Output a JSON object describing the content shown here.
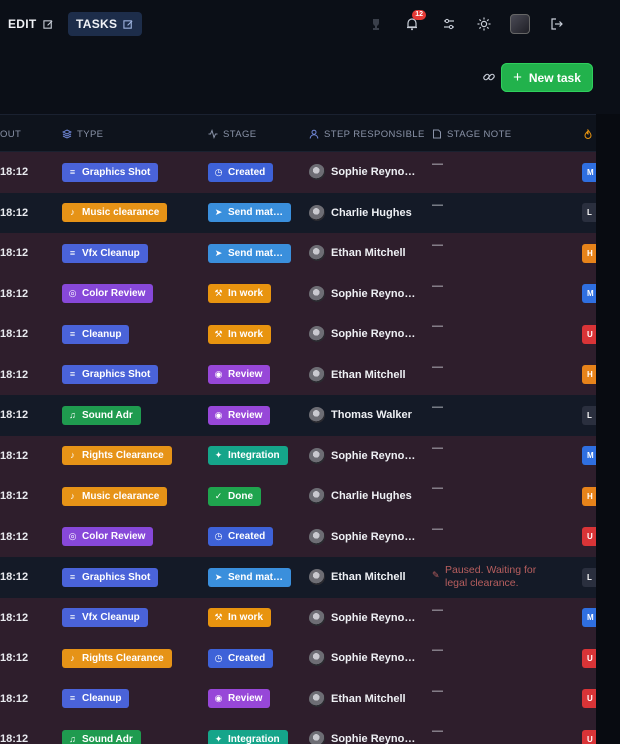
{
  "topbar": {
    "edit_label": "EDIT",
    "tasks_label": "TASKS",
    "notifications_count": "12"
  },
  "actions": {
    "new_task_label": "New task"
  },
  "columns": {
    "time": "OUT",
    "type": "TYPE",
    "stage": "STAGE",
    "responsible": "STEP RESPONSIBLE",
    "note": "STAGE NOTE"
  },
  "rows": [
    {
      "time": "18:12",
      "type": "Graphics Shot",
      "type_color": "blue",
      "stage": "Created",
      "stage_key": "created",
      "person": "Sophie Reyno…",
      "note": "—",
      "priority": "M",
      "priority_color": "blue",
      "bg": "a"
    },
    {
      "time": "18:12",
      "type": "Music clearance",
      "type_color": "orange",
      "stage": "Send mat…",
      "stage_key": "send",
      "person": "Charlie Hughes",
      "note": "—",
      "priority": "L",
      "priority_color": "dark",
      "bg": "b"
    },
    {
      "time": "18:12",
      "type": "Vfx Cleanup",
      "type_color": "blue",
      "stage": "Send mat…",
      "stage_key": "send",
      "person": "Ethan Mitchell",
      "note": "—",
      "priority": "H",
      "priority_color": "orange",
      "bg": "a"
    },
    {
      "time": "18:12",
      "type": "Color Review",
      "type_color": "purple",
      "stage": "In work",
      "stage_key": "inwork",
      "person": "Sophie Reyno…",
      "note": "—",
      "priority": "M",
      "priority_color": "blue",
      "bg": "a"
    },
    {
      "time": "18:12",
      "type": "Cleanup",
      "type_color": "blue",
      "stage": "In work",
      "stage_key": "inwork",
      "person": "Sophie Reyno…",
      "note": "—",
      "priority": "U",
      "priority_color": "red",
      "bg": "a"
    },
    {
      "time": "18:12",
      "type": "Graphics Shot",
      "type_color": "blue",
      "stage": "Review",
      "stage_key": "review",
      "person": "Ethan Mitchell",
      "note": "—",
      "priority": "H",
      "priority_color": "orange",
      "bg": "a"
    },
    {
      "time": "18:12",
      "type": "Sound Adr",
      "type_color": "green",
      "stage": "Review",
      "stage_key": "review",
      "person": "Thomas Walker",
      "note": "—",
      "priority": "L",
      "priority_color": "dark",
      "bg": "b"
    },
    {
      "time": "18:12",
      "type": "Rights Clearance",
      "type_color": "orange",
      "stage": "Integration",
      "stage_key": "integration",
      "person": "Sophie Reyno…",
      "note": "—",
      "priority": "M",
      "priority_color": "blue",
      "bg": "a"
    },
    {
      "time": "18:12",
      "type": "Music clearance",
      "type_color": "orange",
      "stage": "Done",
      "stage_key": "done",
      "person": "Charlie Hughes",
      "note": "—",
      "priority": "H",
      "priority_color": "orange",
      "bg": "a"
    },
    {
      "time": "18:12",
      "type": "Color Review",
      "type_color": "purple",
      "stage": "Created",
      "stage_key": "created",
      "person": "Sophie Reyno…",
      "note": "—",
      "priority": "U",
      "priority_color": "red",
      "bg": "a"
    },
    {
      "time": "18:12",
      "type": "Graphics Shot",
      "type_color": "blue",
      "stage": "Send mat…",
      "stage_key": "send",
      "person": "Ethan Mitchell",
      "note": "Paused. Waiting for legal clearance.",
      "priority": "L",
      "priority_color": "dark",
      "bg": "b"
    },
    {
      "time": "18:12",
      "type": "Vfx Cleanup",
      "type_color": "blue",
      "stage": "In work",
      "stage_key": "inwork",
      "person": "Sophie Reyno…",
      "note": "—",
      "priority": "M",
      "priority_color": "blue",
      "bg": "a"
    },
    {
      "time": "18:12",
      "type": "Rights Clearance",
      "type_color": "orange",
      "stage": "Created",
      "stage_key": "created",
      "person": "Sophie Reyno…",
      "note": "—",
      "priority": "U",
      "priority_color": "red",
      "bg": "a"
    },
    {
      "time": "18:12",
      "type": "Cleanup",
      "type_color": "blue",
      "stage": "Review",
      "stage_key": "review",
      "person": "Ethan Mitchell",
      "note": "—",
      "priority": "U",
      "priority_color": "red",
      "bg": "a"
    },
    {
      "time": "18:12",
      "type": "Sound Adr",
      "type_color": "green",
      "stage": "Integration",
      "stage_key": "integration",
      "person": "Sophie Reyno…",
      "note": "—",
      "priority": "U",
      "priority_color": "red",
      "bg": "a"
    }
  ]
}
